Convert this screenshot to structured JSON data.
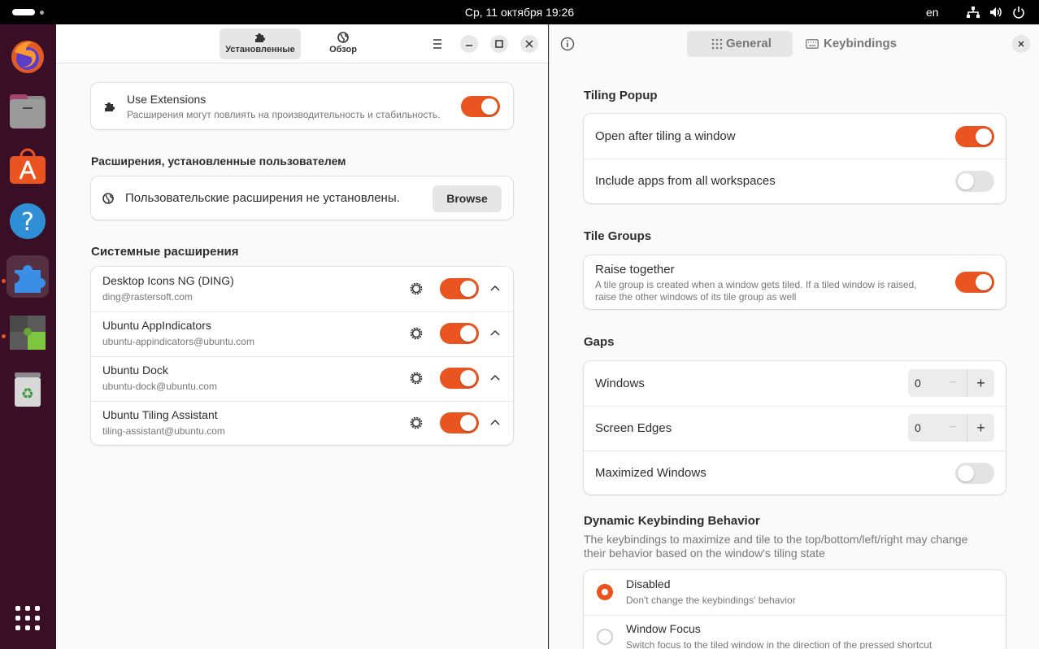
{
  "topbar": {
    "clock": "Ср, 11 октября  19:26",
    "keyboard_layout": "en",
    "tray_icons": [
      "network-icon",
      "volume-icon",
      "power-icon"
    ]
  },
  "dock": {
    "apps": [
      "firefox",
      "files",
      "app-center",
      "help",
      "extensions",
      "extension-manager",
      "trash"
    ],
    "show_apps": "grid-icon"
  },
  "extensions_window": {
    "tabs": [
      {
        "label": "Установленные",
        "icon": "puzzle-icon",
        "selected": true
      },
      {
        "label": "Обзор",
        "icon": "globe-icon",
        "selected": false
      }
    ],
    "use_extensions": {
      "title": "Use Extensions",
      "subtitle": "Расширения могут повлиять на производительность и стабильность.",
      "enabled": true
    },
    "user_section": {
      "title": "Расширения, установленные пользователем",
      "empty_text": "Пользовательские расширения не установлены.",
      "browse_label": "Browse"
    },
    "system_section": {
      "title": "Системные расширения",
      "items": [
        {
          "name": "Desktop Icons NG (DING)",
          "id": "ding@rastersoft.com",
          "enabled": true
        },
        {
          "name": "Ubuntu AppIndicators",
          "id": "ubuntu-appindicators@ubuntu.com",
          "enabled": true
        },
        {
          "name": "Ubuntu Dock",
          "id": "ubuntu-dock@ubuntu.com",
          "enabled": true
        },
        {
          "name": "Ubuntu Tiling Assistant",
          "id": "tiling-assistant@ubuntu.com",
          "enabled": true
        }
      ]
    }
  },
  "tiling_window": {
    "tabs": [
      {
        "label": "General",
        "icon": "grid-dots-icon",
        "selected": true
      },
      {
        "label": "Keybindings",
        "icon": "keyboard-icon",
        "selected": false
      }
    ],
    "tiling_popup": {
      "title": "Tiling Popup",
      "rows": [
        {
          "label": "Open after tiling a window",
          "enabled": true
        },
        {
          "label": "Include apps from all workspaces",
          "enabled": false
        }
      ]
    },
    "tile_groups": {
      "title": "Tile Groups",
      "raise_together": {
        "label": "Raise together",
        "subtitle_line1": "A tile group is created when a window gets tiled. If a tiled window is raised,",
        "subtitle_line2": "raise the other windows of its tile group as well",
        "enabled": true
      }
    },
    "gaps": {
      "title": "Gaps",
      "windows": {
        "label": "Windows",
        "value": "0"
      },
      "screen_edges": {
        "label": "Screen Edges",
        "value": "0"
      },
      "maximized_windows": {
        "label": "Maximized Windows",
        "enabled": false
      },
      "minus": "−",
      "plus": "+"
    },
    "dynamic": {
      "title": "Dynamic Keybinding Behavior",
      "desc_line1": "The keybindings to maximize and tile to the top/bottom/left/right may change",
      "desc_line2": "their behavior based on the window's tiling state",
      "options": [
        {
          "label": "Disabled",
          "subtitle": "Don't change the keybindings' behavior",
          "checked": true
        },
        {
          "label": "Window Focus",
          "subtitle": "Switch focus to the tiled window in the direction of the pressed shortcut",
          "checked": false
        }
      ]
    }
  },
  "colors": {
    "accent": "#e95420",
    "dock_bg": "#3a0f25",
    "topbar_bg": "#000000"
  }
}
